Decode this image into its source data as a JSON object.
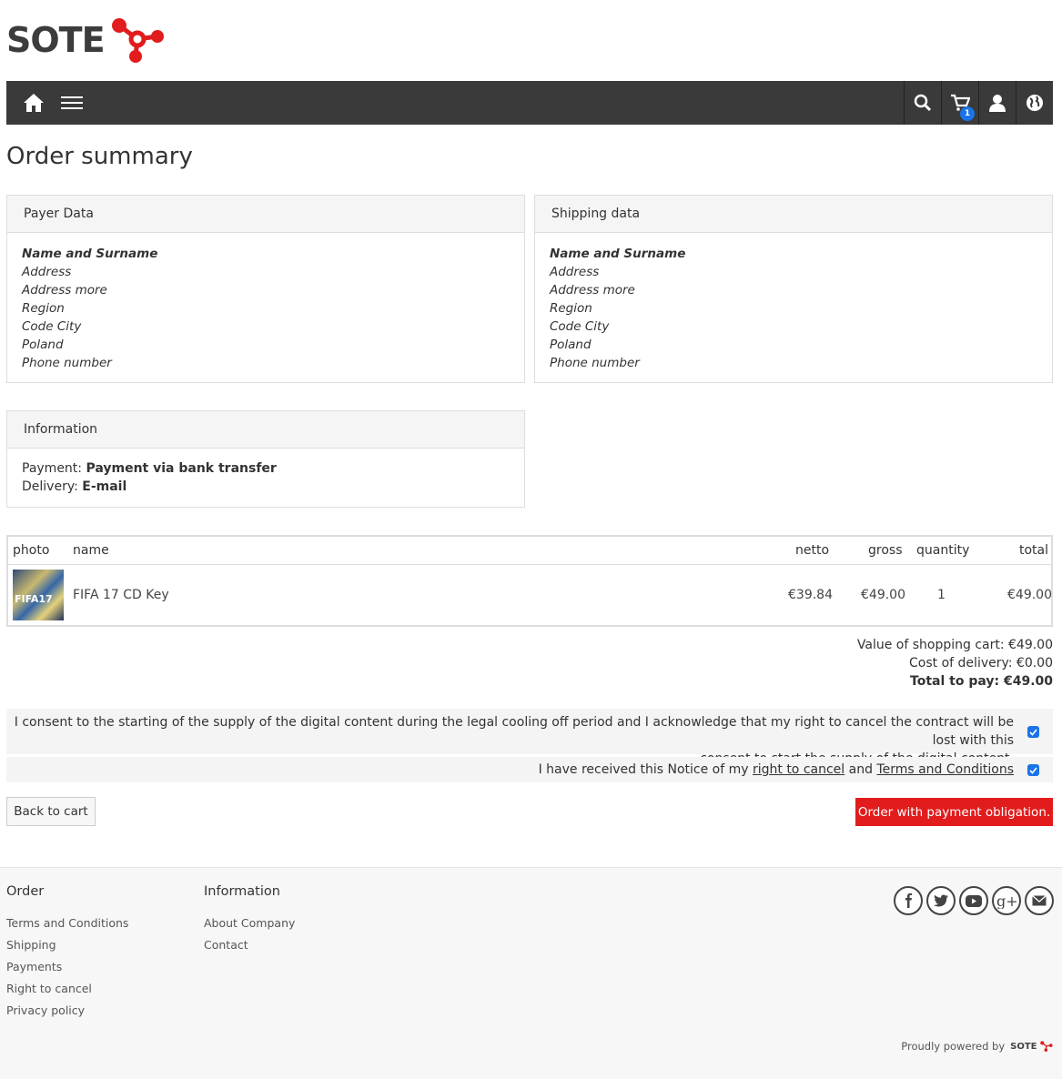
{
  "header": {
    "logo_text": "SOTE",
    "cart_count": "1"
  },
  "nav": {
    "icons": [
      "home-icon",
      "menu-icon",
      "search-icon",
      "cart-icon",
      "user-icon",
      "globe-icon"
    ]
  },
  "page": {
    "title": "Order summary"
  },
  "payer": {
    "heading": "Payer Data",
    "name": "Name and Surname",
    "address": "Address",
    "address_more": "Address more",
    "region": "Region",
    "code_city": "Code City",
    "country": "Poland",
    "phone": "Phone number"
  },
  "shipping": {
    "heading": "Shipping data",
    "name": "Name and Surname",
    "address": "Address",
    "address_more": "Address more",
    "region": "Region",
    "code_city": "Code City",
    "country": "Poland",
    "phone": "Phone number"
  },
  "information": {
    "heading": "Information",
    "payment_label": "Payment:",
    "payment_value": "Payment via bank transfer",
    "delivery_label": "Delivery:",
    "delivery_value": "E-mail"
  },
  "table": {
    "headers": {
      "photo": "photo",
      "name": "name",
      "netto": "netto",
      "gross": "gross",
      "quantity": "quantity",
      "total": "total"
    },
    "rows": [
      {
        "thumb_text": "FIFA17",
        "name": "FIFA 17 CD Key",
        "netto": "€39.84",
        "gross": "€49.00",
        "quantity": "1",
        "total": "€49.00"
      }
    ]
  },
  "totals": {
    "cart_value": "Value of shopping cart: €49.00",
    "delivery_cost": "Cost of delivery: €0.00",
    "total_to_pay": "Total to pay: €49.00"
  },
  "consent": {
    "line1": "I consent to the starting of the supply of the digital content during the legal cooling off period and I acknowledge that my right to cancel the contract will be lost with this",
    "line2": "consent to start the supply of the digital content.",
    "notice_prefix": "I have received this Notice of my",
    "right_to_cancel_link": "right to cancel",
    "and": "and",
    "terms_link": "Terms and Conditions"
  },
  "buttons": {
    "back": "Back to cart",
    "order": "Order with payment obligation."
  },
  "footer": {
    "order_heading": "Order",
    "order_links": [
      "Terms and Conditions",
      "Shipping",
      "Payments",
      "Right to cancel",
      "Privacy policy"
    ],
    "info_heading": "Information",
    "info_links": [
      "About Company",
      "Contact"
    ],
    "social": [
      "facebook-icon",
      "twitter-icon",
      "youtube-icon",
      "google-plus-icon",
      "mail-icon"
    ],
    "powered_by": "Proudly powered by",
    "powered_logo": "SOTE"
  },
  "colors": {
    "accent_red": "#e21c1c",
    "nav_bg": "#3a3a3a",
    "badge_blue": "#1a73e8"
  }
}
